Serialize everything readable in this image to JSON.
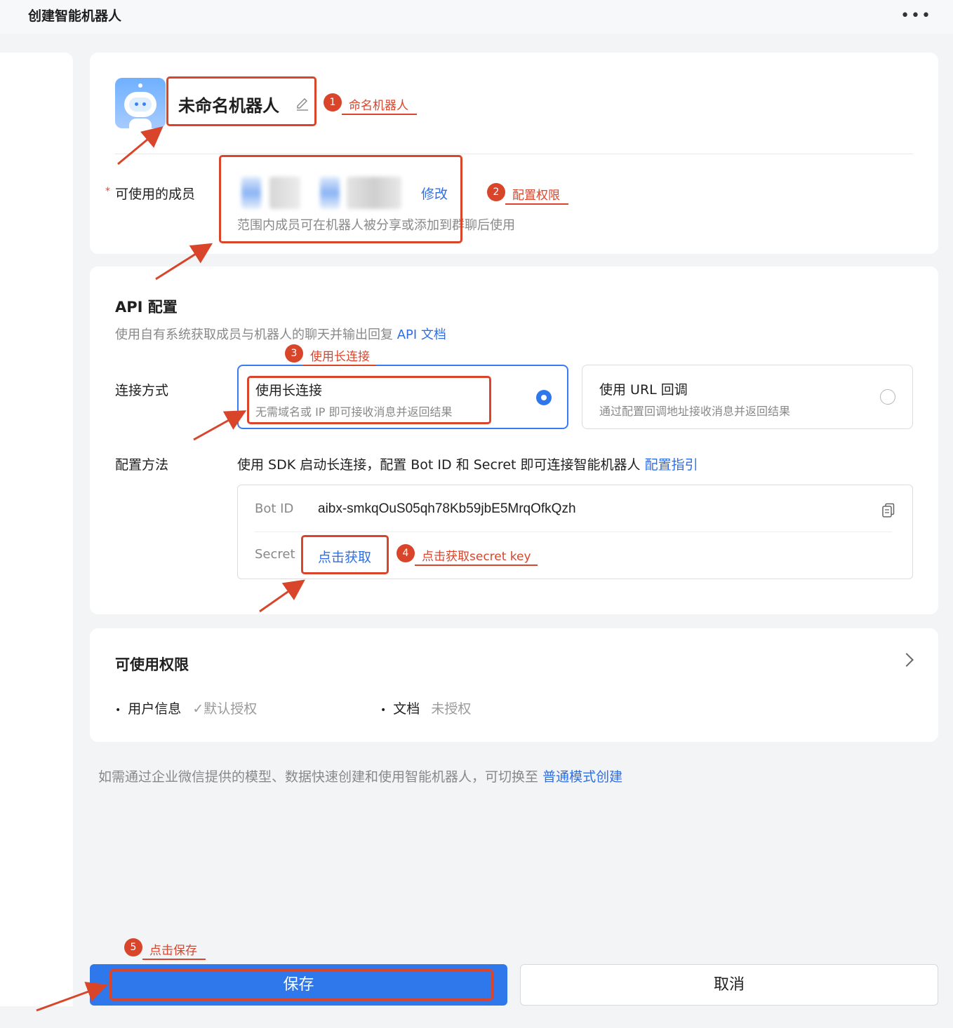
{
  "window": {
    "title": "创建智能机器人",
    "more_label": "•••"
  },
  "bot": {
    "name": "未命名机器人",
    "avatar_icon": "robot-icon",
    "edit_icon": "pencil-icon"
  },
  "members": {
    "label": "可使用的成员",
    "required_mark": "*",
    "modify_label": "修改",
    "hint": "范围内成员可在机器人被分享或添加到群聊后使用"
  },
  "api": {
    "title": "API 配置",
    "desc": "使用自有系统获取成员与机器人的聊天并输出回复",
    "doc_link": "API 文档",
    "connection_label": "连接方式",
    "options": [
      {
        "title": "使用长连接",
        "sub": "无需域名或 IP 即可接收消息并返回结果",
        "selected": true
      },
      {
        "title": "使用 URL 回调",
        "sub": "通过配置回调地址接收消息并返回结果",
        "selected": false
      }
    ],
    "method_label": "配置方法",
    "method_text": "使用 SDK 启动长连接，配置 Bot ID 和 Secret 即可连接智能机器人",
    "guide_link": "配置指引",
    "bot_id_label": "Bot ID",
    "bot_id_value": "aibx-smkqOuS05qh78Kb59jbE5MrqOfkQzh",
    "secret_label": "Secret",
    "secret_action": "点击获取"
  },
  "permissions": {
    "title": "可使用权限",
    "items": [
      {
        "name": "用户信息",
        "state": "默认授权",
        "checked": true
      },
      {
        "name": "文档",
        "state": "未授权",
        "checked": false
      }
    ]
  },
  "footer": {
    "switch_text": "如需通过企业微信提供的模型、数据快速创建和使用智能机器人，可切换至",
    "switch_link": "普通模式创建"
  },
  "buttons": {
    "save": "保存",
    "cancel": "取消"
  },
  "annotations": [
    {
      "num": "1",
      "text": "命名机器人"
    },
    {
      "num": "2",
      "text": "配置权限"
    },
    {
      "num": "3",
      "text": "使用长连接"
    },
    {
      "num": "4",
      "text": "点击获取secret key"
    },
    {
      "num": "5",
      "text": "点击保存"
    }
  ],
  "colors": {
    "accent": "#2f78ec",
    "link": "#2f6fe4",
    "annotation": "#d9452b"
  }
}
